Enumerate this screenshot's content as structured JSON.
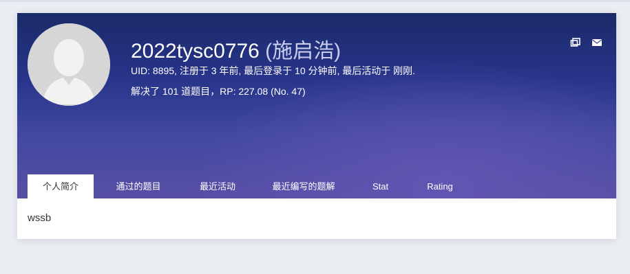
{
  "profile": {
    "username": "2022tysc0776",
    "realname": "(施启浩)",
    "stats_line1": "UID: 8895, 注册于 3 年前, 最后登录于 10 分钟前, 最后活动于 刚刚.",
    "stats_line2": "解决了 101 道题目，RP: 227.08 (No. 47)"
  },
  "icons": {
    "message": "message-icon",
    "mail": "mail-icon"
  },
  "tabs": [
    {
      "label": "个人简介",
      "active": true
    },
    {
      "label": "通过的题目"
    },
    {
      "label": "最近活动"
    },
    {
      "label": "最近编写的题解"
    },
    {
      "label": "Stat"
    },
    {
      "label": "Rating"
    }
  ],
  "bio": {
    "text": "wssb"
  },
  "colors": {
    "banner_top": "#1b2b68",
    "banner_bottom": "#584fa6",
    "page_bg": "#eaeef2"
  }
}
